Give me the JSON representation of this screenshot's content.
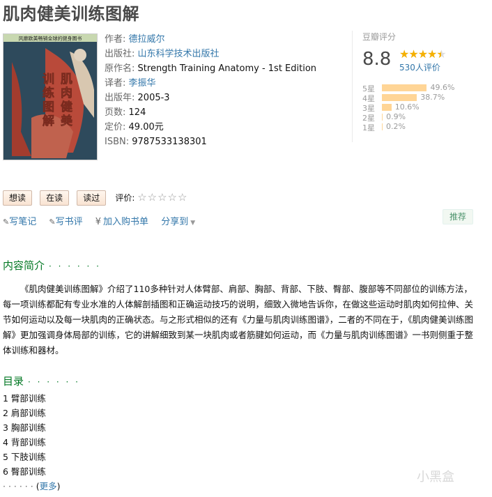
{
  "book": {
    "title": "肌肉健美训练图解",
    "cover_banner": "风靡欧美畅销全球的健身图书",
    "cover_title_chars": [
      "肌",
      "肉",
      "健",
      "美",
      "训",
      "练",
      "图",
      "解"
    ],
    "info": [
      {
        "label": "作者:",
        "value": "德拉威尔",
        "link": true
      },
      {
        "label": "出版社:",
        "value": "山东科学技术出版社",
        "link": true
      },
      {
        "label": "原作名:",
        "value": "Strength Training Anatomy - 1st Edition",
        "link": false
      },
      {
        "label": "译者:",
        "value": "李振华",
        "link": true
      },
      {
        "label": "出版年:",
        "value": "2005-3",
        "link": false
      },
      {
        "label": "页数:",
        "value": "124",
        "link": false
      },
      {
        "label": "定价:",
        "value": "49.00元",
        "link": false
      },
      {
        "label": "ISBN:",
        "value": "9787533138301",
        "link": false
      }
    ]
  },
  "rating": {
    "heading": "豆瓣评分",
    "score": "8.8",
    "stars": "★★★★★",
    "star_fraction": 0.9,
    "count": "530人评价",
    "distribution": [
      {
        "star": "5星",
        "percent": "49.6%",
        "value": 49.6
      },
      {
        "star": "4星",
        "percent": "38.7%",
        "value": 38.7
      },
      {
        "star": "3星",
        "percent": "10.6%",
        "value": 10.6
      },
      {
        "star": "2星",
        "percent": "0.9%",
        "value": 0.9
      },
      {
        "star": "1星",
        "percent": "0.2%",
        "value": 0.2
      }
    ]
  },
  "actions": {
    "want": "想读",
    "reading": "在读",
    "read": "读过",
    "my_rating_label": "评价:",
    "my_rating_stars": "☆☆☆☆☆"
  },
  "links": {
    "write_note": "写笔记",
    "write_review": "写书评",
    "add_cart_symbol": "¥",
    "add_cart": "加入购书单",
    "share": "分享到",
    "recommend": "推荐"
  },
  "intro": {
    "heading": "内容简介",
    "dots": "· · · · · ·",
    "text": "《肌肉健美训练图解》介绍了110多种针对人体臂部、肩部、胸部、背部、下肢、臀部、腹部等不同部位的训练方法，每一项训练都配有专业水准的人体解剖插图和正确运动技巧的说明，细致入微地告诉你，在做这些运动时肌肉如何拉伸、关节如何运动以及每一块肌肉的正确状态。与之形式相似的还有《力量与肌肉训练图谱》，二者的不同在于，《肌肉健美训练图解》更加强调身体局部的训练，它的讲解细致到某一块肌肉或者筋腱如何运动，而《力量与肌肉训练图谱》一书则侧重于整体训练和器材。"
  },
  "toc": {
    "heading": "目录",
    "dots": "· · · · · ·",
    "items": [
      "1 臂部训练",
      "2 肩部训练",
      "3 胸部训练",
      "4 背部训练",
      "5 下肢训练",
      "6 臀部训练"
    ],
    "more_dots": "· · · · · ·",
    "more": "更多"
  },
  "watermark": "小黑盒",
  "colors": {
    "link": "#3377aa",
    "section": "#007722",
    "star": "#f5b000",
    "bar": "#ffd596"
  }
}
